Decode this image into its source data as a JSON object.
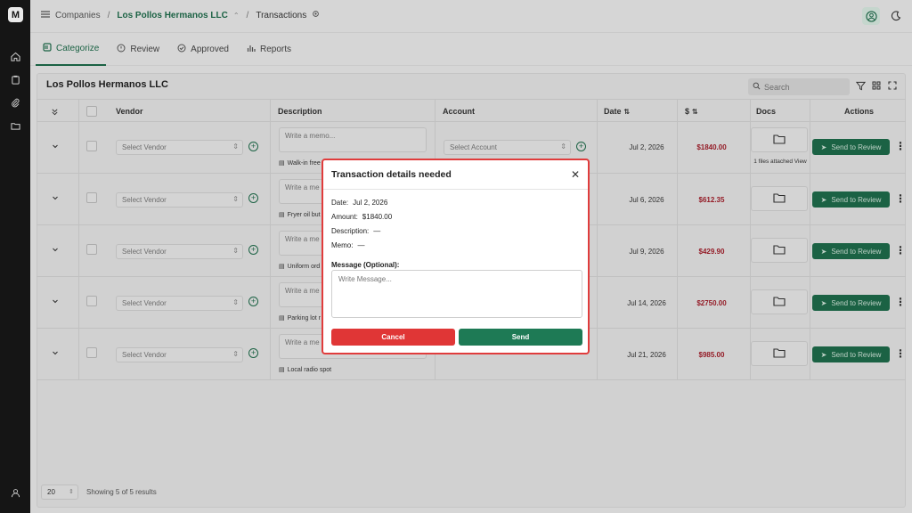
{
  "breadcrumb": {
    "companies": "Companies",
    "company": "Los Pollos Hermanos LLC",
    "page": "Transactions"
  },
  "tabs": [
    {
      "label": "Categorize",
      "icon": "categorize-icon",
      "active": true
    },
    {
      "label": "Review",
      "icon": "review-icon"
    },
    {
      "label": "Approved",
      "icon": "approved-icon"
    },
    {
      "label": "Reports",
      "icon": "reports-icon"
    }
  ],
  "card": {
    "title": "Los Pollos Hermanos LLC",
    "search_placeholder": "Search"
  },
  "columns": {
    "vendor": "Vendor",
    "description": "Description",
    "account": "Account",
    "date": "Date",
    "amount": "$",
    "docs": "Docs",
    "actions": "Actions"
  },
  "placeholders": {
    "vendor": "Select Vendor",
    "memo": "Write a memo...",
    "memo_short": "Write a me",
    "account": "Select Account"
  },
  "send_label": "Send to Review",
  "rows": [
    {
      "date": "Jul 2, 2026",
      "amount": "$1840.00",
      "attachment": "Walk-in free",
      "files": "1 files attached View"
    },
    {
      "date": "Jul 6, 2026",
      "amount": "$612.35",
      "attachment": "Fryer oil but",
      "files": ""
    },
    {
      "date": "Jul 9, 2026",
      "amount": "$429.90",
      "attachment": "Uniform ord",
      "files": ""
    },
    {
      "date": "Jul 14, 2026",
      "amount": "$2750.00",
      "attachment": "Parking lot r",
      "files": ""
    },
    {
      "date": "Jul 21, 2026",
      "amount": "$985.00",
      "attachment": "Local radio spot",
      "files": ""
    }
  ],
  "footer": {
    "page_size": "20",
    "showing": "Showing 5 of 5 results"
  },
  "modal": {
    "title": "Transaction details needed",
    "date_label": "Date:",
    "date_value": "Jul 2, 2026",
    "amount_label": "Amount:",
    "amount_value": "$1840.00",
    "description_label": "Description:",
    "description_value": "—",
    "memo_label": "Memo:",
    "memo_value": "—",
    "message_label": "Message (Optional):",
    "message_placeholder": "Write Message...",
    "cancel": "Cancel",
    "send": "Send"
  },
  "colors": {
    "brand_green": "#1e6b4a",
    "danger_red": "#e03636",
    "amount_red": "#a11e2a"
  }
}
